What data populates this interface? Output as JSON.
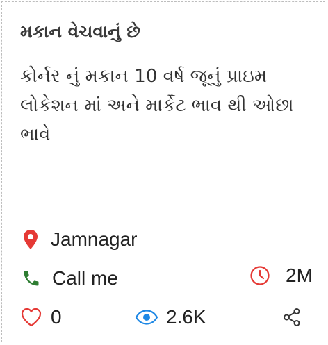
{
  "listing": {
    "title": "મકાન વેચવાનું છે",
    "description": "કોર્નર નું મકાન 10 વર્ષ જૂનું પ્રાઇમ લોકેશન માં અને માર્કેટ ભાવ થી ઓછા ભાવે",
    "location": "Jamnagar",
    "call_label": "Call me",
    "posted_ago": "2M",
    "likes": "0",
    "views": "2.6K"
  },
  "icons": {
    "location": "location-pin-icon",
    "call": "phone-icon",
    "time": "clock-icon",
    "likes": "heart-icon",
    "views": "eye-icon",
    "share": "share-icon"
  },
  "colors": {
    "location_pin": "#e53935",
    "phone": "#2e7d32",
    "clock": "#e53935",
    "heart": "#e53935",
    "eye": "#1e88e5",
    "share": "#333333",
    "border": "#bdbdbd"
  }
}
